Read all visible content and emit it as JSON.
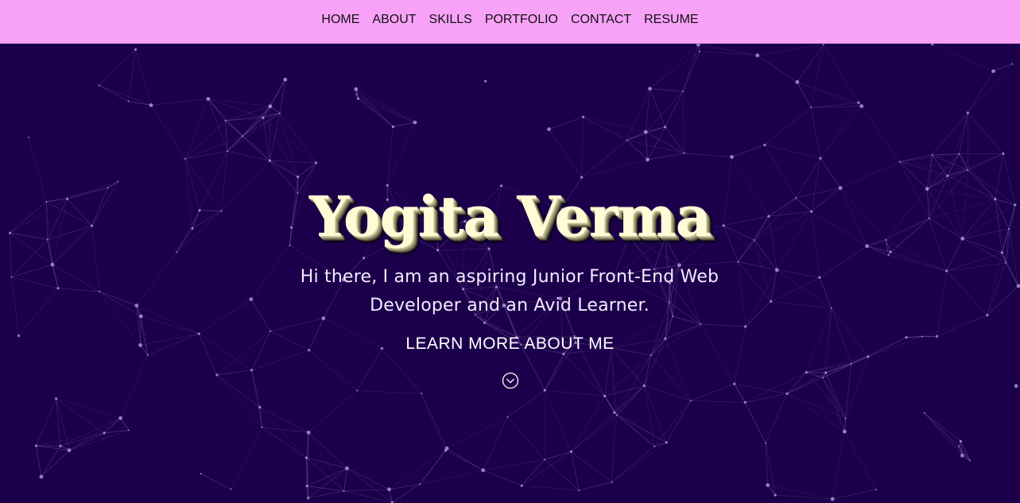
{
  "nav": {
    "items": [
      {
        "label": "HOME"
      },
      {
        "label": "ABOUT"
      },
      {
        "label": "SKILLS"
      },
      {
        "label": "PORTFOLIO"
      },
      {
        "label": "CONTACT"
      },
      {
        "label": "RESUME"
      }
    ]
  },
  "hero": {
    "title": "Yogita Verma",
    "subtitle": "Hi there, I am an aspiring Junior Front-End Web Developer and an Avid Learner.",
    "cta": "LEARN MORE ABOUT ME",
    "scroll_icon": "chevron-down-circle-icon"
  },
  "colors": {
    "nav_background": "#f7a2f7",
    "page_background": "#1c004b",
    "title": "#fffbd6",
    "network_lines": "#8a6fc2"
  }
}
